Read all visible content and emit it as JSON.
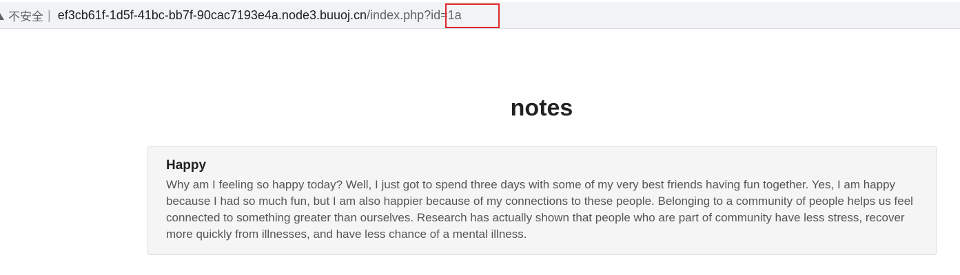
{
  "browser": {
    "security_label": "不安全",
    "separator": "|",
    "url_host": "ef3cb61f-1d5f-41bc-bb7f-90cac7193e4a.node3.buuoj.cn",
    "url_path": "/index.php",
    "url_query": "?id=1a",
    "highlight_color": "#e0262a"
  },
  "page": {
    "title": "notes",
    "note": {
      "heading": "Happy",
      "body": "Why am I feeling so happy today? Well, I just got to spend three days with some of my very best friends having fun together. Yes, I am happy because I had so much fun, but I am also happier because of my connections to these people. Belonging to a community of people helps us feel connected to something greater than ourselves. Research has actually shown that people who are part of community have less stress, recover more quickly from illnesses, and have less chance of a mental illness."
    }
  }
}
